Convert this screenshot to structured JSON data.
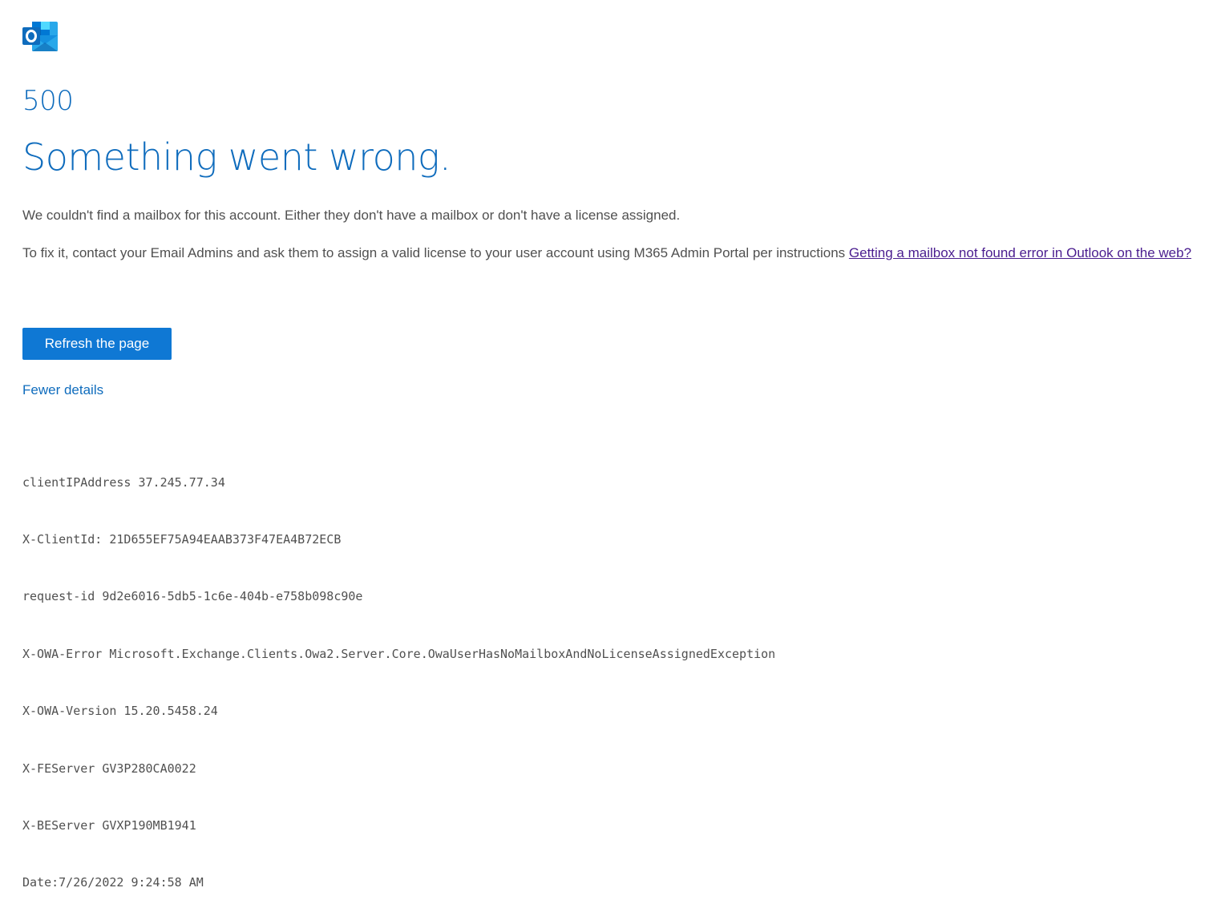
{
  "app": {
    "logo_icon": "outlook-logo-icon",
    "brand_color": "#0f6cbd",
    "button_color": "#0f78d4",
    "link_visited_color": "#4a1d8f"
  },
  "error": {
    "code": "500",
    "headline": "Something went wrong.",
    "message1": "We couldn't find a mailbox for this account. Either they don't have a mailbox or don't have a license assigned.",
    "message2_prefix": "To fix it, contact your Email Admins and ask them to assign a valid license to your user account using M365 Admin Portal per instructions ",
    "help_link_text": "Getting a mailbox not found error in Outlook on the web?"
  },
  "actions": {
    "refresh_label": "Refresh the page",
    "details_toggle_label": "Fewer details"
  },
  "diagnostics": {
    "lines": [
      "clientIPAddress 37.245.77.34",
      "X-ClientId: 21D655EF75A94EAAB373F47EA4B72ECB",
      "request-id 9d2e6016-5db5-1c6e-404b-e758b098c90e",
      "X-OWA-Error Microsoft.Exchange.Clients.Owa2.Server.Core.OwaUserHasNoMailboxAndNoLicenseAssignedException",
      "X-OWA-Version 15.20.5458.24",
      "X-FEServer GV3P280CA0022",
      "X-BEServer GVXP190MB1941",
      "Date:7/26/2022 9:24:58 AM"
    ]
  }
}
